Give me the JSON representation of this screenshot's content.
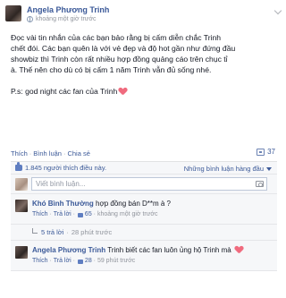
{
  "post": {
    "author": "Angela Phương Trinh",
    "time": "khoảng một giờ trước",
    "body_lines": [
      "Đọc vài tin nhắn của các bạn bảo rằng bị cấm diễn chắc Trinh",
      "chết đói. Các bạn quên là với vẻ đẹp và độ hot gần như đứng đầu",
      "showbiz thì Trinh còn rất nhiều hợp đồng quảng cáo trên chục tỉ",
      "à. Thế nên cho dù có bị cấm 1 năm Trinh vẫn đủ sống nhé."
    ],
    "ps": "P.s: god night các fan của Trinh"
  },
  "actions": {
    "like": "Thích",
    "comment": "Bình luận",
    "share": "Chia sẻ",
    "share_count": "37"
  },
  "likes": {
    "summary": "1.845 người thích điều này.",
    "filter": "Những bình luận hàng đầu"
  },
  "compose": {
    "placeholder": "Viết bình luận..."
  },
  "comments": [
    {
      "author": "Khó Bình Thường",
      "text": "hợp đồng bán D**m à ?",
      "like": "Thích",
      "reply": "Trả lời",
      "likes": "65",
      "time": "khoảng một giờ trước",
      "replies": "5 trả lời",
      "reply_time": "28 phút trước"
    },
    {
      "author": "Angela Phương Trinh",
      "text": "Trinh biết các fan luôn ủng hộ Trinh mà",
      "like": "Thích",
      "reply": "Trả lời",
      "likes": "28",
      "time": "59 phút trước"
    }
  ],
  "colors": {
    "link": "#3b5998",
    "panel": "#f6f7f9",
    "heart": "#f06b7e"
  }
}
